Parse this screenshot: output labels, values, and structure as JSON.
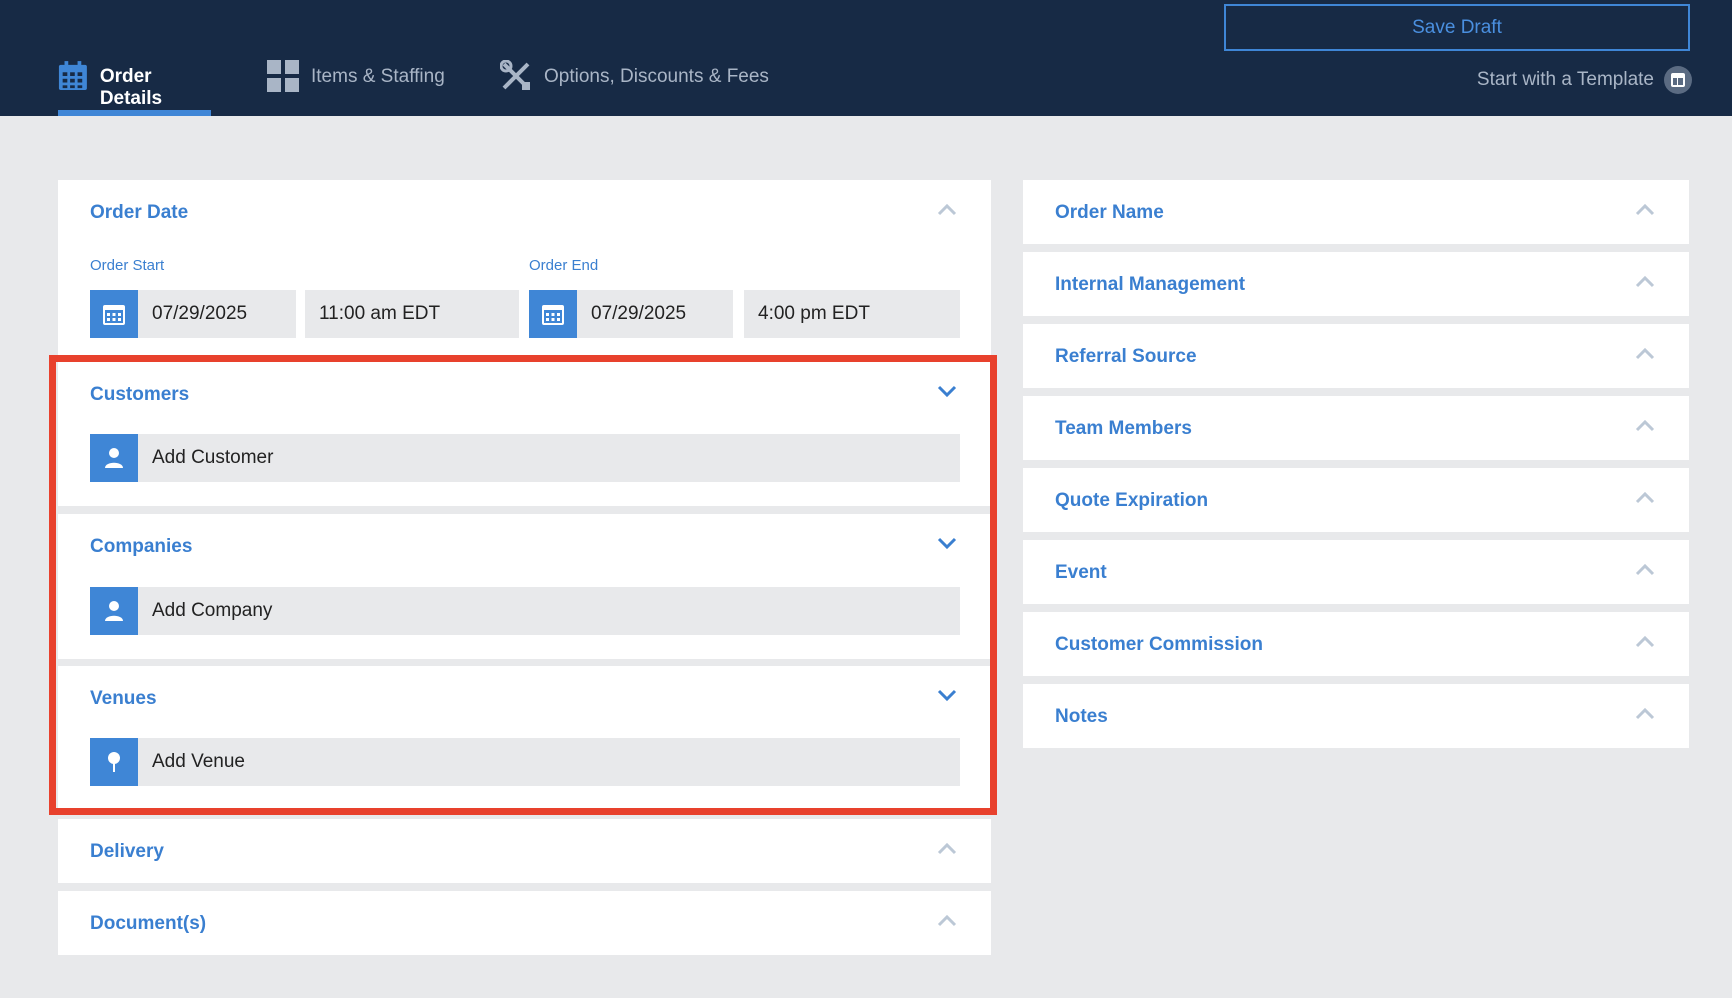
{
  "header": {
    "save_draft": "Save Draft",
    "tabs": [
      {
        "label": "Order Details",
        "icon": "calendar-icon",
        "active": true
      },
      {
        "label": "Items & Staffing",
        "icon": "grid-icon",
        "active": false
      },
      {
        "label": "Options, Discounts & Fees",
        "icon": "tools-icon",
        "active": false
      }
    ],
    "template_link": "Start with a Template"
  },
  "order_date": {
    "title": "Order Date",
    "start_label": "Order Start",
    "end_label": "Order End",
    "start_date": "07/29/2025",
    "start_time": "11:00 am EDT",
    "end_date": "07/29/2025",
    "end_time": "4:00 pm EDT"
  },
  "customers": {
    "title": "Customers",
    "add_label": "Add Customer"
  },
  "companies": {
    "title": "Companies",
    "add_label": "Add Company"
  },
  "venues": {
    "title": "Venues",
    "add_label": "Add Venue"
  },
  "delivery": {
    "title": "Delivery"
  },
  "documents": {
    "title": "Document(s)"
  },
  "right_panels": [
    "Order Name",
    "Internal Management",
    "Referral Source",
    "Team Members",
    "Quote Expiration",
    "Event",
    "Customer Commission",
    "Notes"
  ],
  "colors": {
    "header_bg": "#172a45",
    "accent": "#3f86d6",
    "title_blue": "#3a7fd0",
    "highlight": "#e8412d",
    "page_bg": "#e8e9eb"
  }
}
